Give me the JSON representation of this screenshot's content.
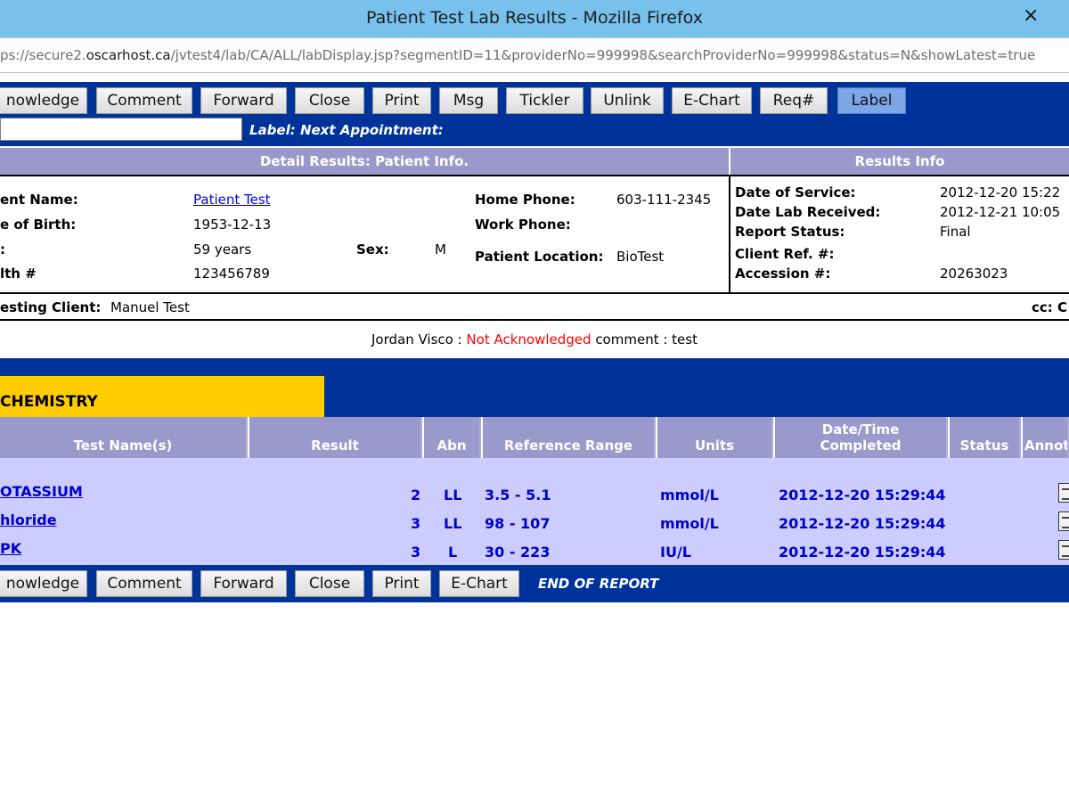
{
  "window": {
    "title": "Patient Test Lab Results - Mozilla Firefox",
    "close_glyph": "×"
  },
  "urlbar": {
    "url_prefix": "ps://secure2.",
    "url_host": "oscarhost.ca",
    "url_rest": "/jvtest4/lab/CA/ALL/labDisplay.jsp?segmentID=11&providerNo=999998&searchProviderNo=999998&status=N&showLatest=true"
  },
  "toolbar_top": {
    "buttons": [
      "nowledge",
      "Comment",
      "Forward",
      "Close",
      "Print",
      "Msg",
      "Tickler",
      "Unlink",
      "E-Chart",
      "Req#",
      "Label"
    ],
    "label_caption": "Label: Next Appointment:"
  },
  "patient_info": {
    "header": "Detail Results: Patient Info.",
    "name_label": "ent Name:",
    "name_value": "Patient Test",
    "dob_label": "e of Birth:",
    "dob_value": "1953-12-13",
    "age_label": ":",
    "age_value": "59 years",
    "sex_label": "Sex:",
    "sex_value": "M",
    "health_label": "lth #",
    "health_value": "123456789",
    "home_phone_label": "Home Phone:",
    "home_phone_value": "603-111-2345",
    "work_phone_label": "Work Phone:",
    "work_phone_value": "",
    "location_label": "Patient Location:",
    "location_value": "BioTest"
  },
  "results_info": {
    "header": "Results Info",
    "date_of_service_label": "Date of Service:",
    "date_of_service_value": "2012-12-20 15:22",
    "date_received_label": "Date Lab Received:",
    "date_received_value": "2012-12-21 10:05",
    "report_status_label": "Report Status:",
    "report_status_value": "Final",
    "client_ref_label": "Client Ref. #:",
    "client_ref_value": "",
    "accession_label": "Accession #:",
    "accession_value": "20263023"
  },
  "client_row": {
    "label": "esting Client:",
    "value": "Manuel Test",
    "cc_label": "cc: C"
  },
  "ack_row": {
    "name": "Jordan Visco : ",
    "status": "Not Acknowledged",
    "comment": " comment : test"
  },
  "results": {
    "department": "CHEMISTRY",
    "columns": [
      "Test Name(s)",
      "Result",
      "Abn",
      "Reference Range",
      "Units",
      "Date/Time Completed",
      "Status",
      "Annot"
    ],
    "rows": [
      {
        "test": "OTASSIUM",
        "result": "2",
        "abn": "LL",
        "range": "3.5 - 5.1",
        "units": "mmol/L",
        "completed": "2012-12-20 15:29:44"
      },
      {
        "test": "hloride",
        "result": "3",
        "abn": "LL",
        "range": "98 - 107",
        "units": "mmol/L",
        "completed": "2012-12-20 15:29:44"
      },
      {
        "test": "PK",
        "result": "3",
        "abn": "L",
        "range": "30 - 223",
        "units": "IU/L",
        "completed": "2012-12-20 15:29:44"
      }
    ]
  },
  "toolbar_bottom": {
    "buttons": [
      "nowledge",
      "Comment",
      "Forward",
      "Close",
      "Print",
      "E-Chart"
    ],
    "end_text": "END OF REPORT"
  },
  "colors": {
    "toolbar_blue": "#003399",
    "header_lavender": "#9999cc",
    "results_bg": "#ccccff",
    "department_yellow": "#ffcc00",
    "alert_red": "#ff0000"
  }
}
